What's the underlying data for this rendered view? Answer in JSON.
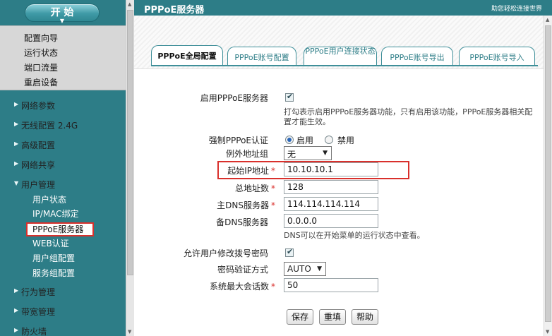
{
  "sidebar": {
    "start_label": "开 始",
    "start_items": [
      "配置向导",
      "运行状态",
      "端口流量",
      "重启设备"
    ],
    "sections": {
      "network_params": "网络参数",
      "wireless": "无线配置 2.4G",
      "advanced": "高级配置",
      "network_share": "网络共享",
      "user_mgmt": "用户管理",
      "behavior": "行为管理",
      "bandwidth": "带宽管理",
      "firewall": "防火墙"
    },
    "user_items": [
      "用户状态",
      "IP/MAC绑定",
      "PPPoE服务器",
      "WEB认证",
      "用户组配置",
      "服务组配置"
    ]
  },
  "header": {
    "title": "PPPoE服务器",
    "help_text": "助您轻松连接世界"
  },
  "tabs": [
    {
      "label": "PPPoE全局配置",
      "active": true
    },
    {
      "label": "PPPoE账号配置",
      "active": false
    },
    {
      "label": "PPPoE用户连接状态",
      "active": false
    },
    {
      "label": "PPPoE账号导出",
      "active": false
    },
    {
      "label": "PPPoE账号导入",
      "active": false
    }
  ],
  "form": {
    "enable_server": {
      "label": "启用PPPoE服务器",
      "checked": true,
      "hint": "打勾表示启用PPPoE服务器功能，只有启用该功能，PPPoE服务器相关配置才能生效。"
    },
    "force_auth": {
      "label": "强制PPPoE认证",
      "option_enable": "启用",
      "option_disable": "禁用",
      "selected": "启用"
    },
    "exception_group": {
      "label": "例外地址组",
      "value": "无"
    },
    "start_ip": {
      "label": "起始IP地址",
      "required": "*",
      "value": "10.10.10.1"
    },
    "total_addresses": {
      "label": "总地址数",
      "required": "*",
      "value": "128"
    },
    "primary_dns": {
      "label": "主DNS服务器",
      "required": "*",
      "value": "114.114.114.114"
    },
    "secondary_dns": {
      "label": "备DNS服务器",
      "value": "0.0.0.0",
      "hint": "DNS可以在开始菜单的运行状态中查看。"
    },
    "allow_modify_pwd": {
      "label": "允许用户修改拨号密码",
      "checked": true
    },
    "auth_method": {
      "label": "密码验证方式",
      "value": "AUTO"
    },
    "max_sessions": {
      "label": "系统最大会话数",
      "required": "*",
      "value": "50"
    }
  },
  "buttons": {
    "save": "保存",
    "reset": "重填",
    "help": "帮助"
  },
  "colors": {
    "accent": "#2d7d87",
    "highlight": "#d9302c"
  }
}
